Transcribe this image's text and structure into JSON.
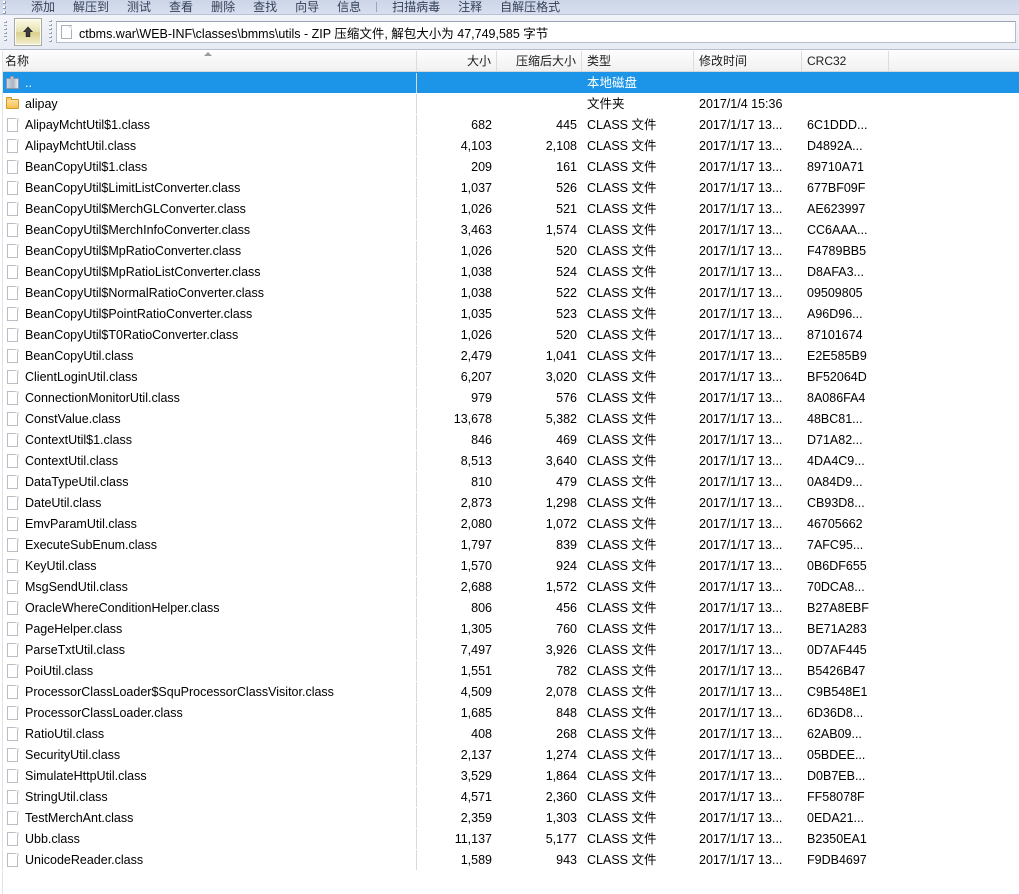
{
  "toolbar": {
    "buttons": [
      {
        "label": "添加",
        "name": "add"
      },
      {
        "label": "解压到",
        "name": "extract-to"
      },
      {
        "label": "测试",
        "name": "test"
      },
      {
        "label": "查看",
        "name": "view"
      },
      {
        "label": "删除",
        "name": "delete"
      },
      {
        "label": "查找",
        "name": "find"
      },
      {
        "label": "向导",
        "name": "wizard"
      },
      {
        "label": "信息",
        "name": "info"
      }
    ],
    "buttons_after_sep": [
      {
        "label": "扫描病毒",
        "name": "virus-scan"
      },
      {
        "label": "注释",
        "name": "comment"
      },
      {
        "label": "自解压格式",
        "name": "sfx"
      }
    ]
  },
  "addressbar": {
    "up_button_title": "上一层",
    "path": "ctbms.war\\WEB-INF\\classes\\bmms\\utils - ZIP 压缩文件, 解包大小为 47,749,585 字节"
  },
  "columns": {
    "name": "名称",
    "size": "大小",
    "packed_size": "压缩后大小",
    "type": "类型",
    "modified": "修改时间",
    "crc32": "CRC32"
  },
  "rows": [
    {
      "icon": "up-folder-icon",
      "name": "..",
      "size": "",
      "packed": "",
      "type": "本地磁盘",
      "date": "",
      "crc": "",
      "selected": true
    },
    {
      "icon": "folder-icon",
      "name": "alipay",
      "size": "",
      "packed": "",
      "type": "文件夹",
      "date": "2017/1/4 15:36",
      "crc": "",
      "selected": false
    },
    {
      "icon": "file-icon",
      "name": "AlipayMchtUtil$1.class",
      "size": "682",
      "packed": "445",
      "type": "CLASS 文件",
      "date": "2017/1/17 13...",
      "crc": "6C1DDD...",
      "selected": false
    },
    {
      "icon": "file-icon",
      "name": "AlipayMchtUtil.class",
      "size": "4,103",
      "packed": "2,108",
      "type": "CLASS 文件",
      "date": "2017/1/17 13...",
      "crc": "D4892A...",
      "selected": false
    },
    {
      "icon": "file-icon",
      "name": "BeanCopyUtil$1.class",
      "size": "209",
      "packed": "161",
      "type": "CLASS 文件",
      "date": "2017/1/17 13...",
      "crc": "89710A71",
      "selected": false
    },
    {
      "icon": "file-icon",
      "name": "BeanCopyUtil$LimitListConverter.class",
      "size": "1,037",
      "packed": "526",
      "type": "CLASS 文件",
      "date": "2017/1/17 13...",
      "crc": "677BF09F",
      "selected": false
    },
    {
      "icon": "file-icon",
      "name": "BeanCopyUtil$MerchGLConverter.class",
      "size": "1,026",
      "packed": "521",
      "type": "CLASS 文件",
      "date": "2017/1/17 13...",
      "crc": "AE623997",
      "selected": false
    },
    {
      "icon": "file-icon",
      "name": "BeanCopyUtil$MerchInfoConverter.class",
      "size": "3,463",
      "packed": "1,574",
      "type": "CLASS 文件",
      "date": "2017/1/17 13...",
      "crc": "CC6AAA...",
      "selected": false
    },
    {
      "icon": "file-icon",
      "name": "BeanCopyUtil$MpRatioConverter.class",
      "size": "1,026",
      "packed": "520",
      "type": "CLASS 文件",
      "date": "2017/1/17 13...",
      "crc": "F4789BB5",
      "selected": false
    },
    {
      "icon": "file-icon",
      "name": "BeanCopyUtil$MpRatioListConverter.class",
      "size": "1,038",
      "packed": "524",
      "type": "CLASS 文件",
      "date": "2017/1/17 13...",
      "crc": "D8AFA3...",
      "selected": false
    },
    {
      "icon": "file-icon",
      "name": "BeanCopyUtil$NormalRatioConverter.class",
      "size": "1,038",
      "packed": "522",
      "type": "CLASS 文件",
      "date": "2017/1/17 13...",
      "crc": "09509805",
      "selected": false
    },
    {
      "icon": "file-icon",
      "name": "BeanCopyUtil$PointRatioConverter.class",
      "size": "1,035",
      "packed": "523",
      "type": "CLASS 文件",
      "date": "2017/1/17 13...",
      "crc": "A96D96...",
      "selected": false
    },
    {
      "icon": "file-icon",
      "name": "BeanCopyUtil$T0RatioConverter.class",
      "size": "1,026",
      "packed": "520",
      "type": "CLASS 文件",
      "date": "2017/1/17 13...",
      "crc": "87101674",
      "selected": false
    },
    {
      "icon": "file-icon",
      "name": "BeanCopyUtil.class",
      "size": "2,479",
      "packed": "1,041",
      "type": "CLASS 文件",
      "date": "2017/1/17 13...",
      "crc": "E2E585B9",
      "selected": false
    },
    {
      "icon": "file-icon",
      "name": "ClientLoginUtil.class",
      "size": "6,207",
      "packed": "3,020",
      "type": "CLASS 文件",
      "date": "2017/1/17 13...",
      "crc": "BF52064D",
      "selected": false
    },
    {
      "icon": "file-icon",
      "name": "ConnectionMonitorUtil.class",
      "size": "979",
      "packed": "576",
      "type": "CLASS 文件",
      "date": "2017/1/17 13...",
      "crc": "8A086FA4",
      "selected": false
    },
    {
      "icon": "file-icon",
      "name": "ConstValue.class",
      "size": "13,678",
      "packed": "5,382",
      "type": "CLASS 文件",
      "date": "2017/1/17 13...",
      "crc": "48BC81...",
      "selected": false
    },
    {
      "icon": "file-icon",
      "name": "ContextUtil$1.class",
      "size": "846",
      "packed": "469",
      "type": "CLASS 文件",
      "date": "2017/1/17 13...",
      "crc": "D71A82...",
      "selected": false
    },
    {
      "icon": "file-icon",
      "name": "ContextUtil.class",
      "size": "8,513",
      "packed": "3,640",
      "type": "CLASS 文件",
      "date": "2017/1/17 13...",
      "crc": "4DA4C9...",
      "selected": false
    },
    {
      "icon": "file-icon",
      "name": "DataTypeUtil.class",
      "size": "810",
      "packed": "479",
      "type": "CLASS 文件",
      "date": "2017/1/17 13...",
      "crc": "0A84D9...",
      "selected": false
    },
    {
      "icon": "file-icon",
      "name": "DateUtil.class",
      "size": "2,873",
      "packed": "1,298",
      "type": "CLASS 文件",
      "date": "2017/1/17 13...",
      "crc": "CB93D8...",
      "selected": false
    },
    {
      "icon": "file-icon",
      "name": "EmvParamUtil.class",
      "size": "2,080",
      "packed": "1,072",
      "type": "CLASS 文件",
      "date": "2017/1/17 13...",
      "crc": "46705662",
      "selected": false
    },
    {
      "icon": "file-icon",
      "name": "ExecuteSubEnum.class",
      "size": "1,797",
      "packed": "839",
      "type": "CLASS 文件",
      "date": "2017/1/17 13...",
      "crc": "7AFC95...",
      "selected": false
    },
    {
      "icon": "file-icon",
      "name": "KeyUtil.class",
      "size": "1,570",
      "packed": "924",
      "type": "CLASS 文件",
      "date": "2017/1/17 13...",
      "crc": "0B6DF655",
      "selected": false
    },
    {
      "icon": "file-icon",
      "name": "MsgSendUtil.class",
      "size": "2,688",
      "packed": "1,572",
      "type": "CLASS 文件",
      "date": "2017/1/17 13...",
      "crc": "70DCA8...",
      "selected": false
    },
    {
      "icon": "file-icon",
      "name": "OracleWhereConditionHelper.class",
      "size": "806",
      "packed": "456",
      "type": "CLASS 文件",
      "date": "2017/1/17 13...",
      "crc": "B27A8EBF",
      "selected": false
    },
    {
      "icon": "file-icon",
      "name": "PageHelper.class",
      "size": "1,305",
      "packed": "760",
      "type": "CLASS 文件",
      "date": "2017/1/17 13...",
      "crc": "BE71A283",
      "selected": false
    },
    {
      "icon": "file-icon",
      "name": "ParseTxtUtil.class",
      "size": "7,497",
      "packed": "3,926",
      "type": "CLASS 文件",
      "date": "2017/1/17 13...",
      "crc": "0D7AF445",
      "selected": false
    },
    {
      "icon": "file-icon",
      "name": "PoiUtil.class",
      "size": "1,551",
      "packed": "782",
      "type": "CLASS 文件",
      "date": "2017/1/17 13...",
      "crc": "B5426B47",
      "selected": false
    },
    {
      "icon": "file-icon",
      "name": "ProcessorClassLoader$SquProcessorClassVisitor.class",
      "size": "4,509",
      "packed": "2,078",
      "type": "CLASS 文件",
      "date": "2017/1/17 13...",
      "crc": "C9B548E1",
      "selected": false
    },
    {
      "icon": "file-icon",
      "name": "ProcessorClassLoader.class",
      "size": "1,685",
      "packed": "848",
      "type": "CLASS 文件",
      "date": "2017/1/17 13...",
      "crc": "6D36D8...",
      "selected": false
    },
    {
      "icon": "file-icon",
      "name": "RatioUtil.class",
      "size": "408",
      "packed": "268",
      "type": "CLASS 文件",
      "date": "2017/1/17 13...",
      "crc": "62AB09...",
      "selected": false
    },
    {
      "icon": "file-icon",
      "name": "SecurityUtil.class",
      "size": "2,137",
      "packed": "1,274",
      "type": "CLASS 文件",
      "date": "2017/1/17 13...",
      "crc": "05BDEE...",
      "selected": false
    },
    {
      "icon": "file-icon",
      "name": "SimulateHttpUtil.class",
      "size": "3,529",
      "packed": "1,864",
      "type": "CLASS 文件",
      "date": "2017/1/17 13...",
      "crc": "D0B7EB...",
      "selected": false
    },
    {
      "icon": "file-icon",
      "name": "StringUtil.class",
      "size": "4,571",
      "packed": "2,360",
      "type": "CLASS 文件",
      "date": "2017/1/17 13...",
      "crc": "FF58078F",
      "selected": false
    },
    {
      "icon": "file-icon",
      "name": "TestMerchAnt.class",
      "size": "2,359",
      "packed": "1,303",
      "type": "CLASS 文件",
      "date": "2017/1/17 13...",
      "crc": "0EDA21...",
      "selected": false
    },
    {
      "icon": "file-icon",
      "name": "Ubb.class",
      "size": "11,137",
      "packed": "5,177",
      "type": "CLASS 文件",
      "date": "2017/1/17 13...",
      "crc": "B2350EA1",
      "selected": false
    },
    {
      "icon": "file-icon",
      "name": "UnicodeReader.class",
      "size": "1,589",
      "packed": "943",
      "type": "CLASS 文件",
      "date": "2017/1/17 13...",
      "crc": "F9DB4697",
      "selected": false
    }
  ],
  "colors": {
    "selection": "#1c95e8",
    "toolbar_bg": "#d6dcea",
    "header_bg": "#f4f4f4"
  }
}
